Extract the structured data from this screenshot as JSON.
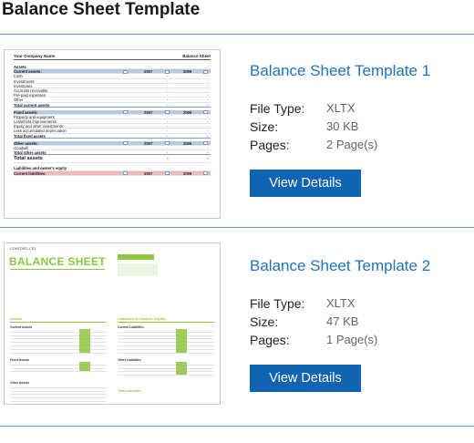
{
  "page": {
    "heading": "Balance Sheet Template"
  },
  "labels": {
    "file_type": "File Type:",
    "size": "Size:",
    "pages": "Pages:"
  },
  "templates": [
    {
      "title": "Balance Sheet Template 1",
      "file_type": "XLTX",
      "size": "30 KB",
      "pages": "2 Page(s)",
      "button": "View Details",
      "thumbnail": {
        "company": "Your Company Name",
        "sheet": "Balance Sheet",
        "rows": [
          {
            "t": "Assets",
            "k": "plain-bold"
          },
          {
            "t": "Current assets:",
            "k": "band",
            "y1": "2007",
            "y2": "2006"
          },
          {
            "t": "Cash",
            "k": "item"
          },
          {
            "t": "Investments",
            "k": "item"
          },
          {
            "t": "Inventories",
            "k": "item"
          },
          {
            "t": "Accounts receivable",
            "k": "item"
          },
          {
            "t": "Pre-paid expenses",
            "k": "item"
          },
          {
            "t": "Other",
            "k": "item"
          },
          {
            "t": "Total current assets",
            "k": "total"
          },
          {
            "t": "",
            "k": "gap"
          },
          {
            "t": "Fixed assets:",
            "k": "band",
            "y1": "2007",
            "y2": "2006"
          },
          {
            "t": "Property and equipment",
            "k": "item"
          },
          {
            "t": "Leasehold improvements",
            "k": "item"
          },
          {
            "t": "Equity and other investments",
            "k": "item"
          },
          {
            "t": "Less accumulated depreciation",
            "k": "item"
          },
          {
            "t": "Total fixed assets",
            "k": "total"
          },
          {
            "t": "",
            "k": "gap"
          },
          {
            "t": "Other assets:",
            "k": "band",
            "y1": "2007",
            "y2": "2006"
          },
          {
            "t": "Goodwill",
            "k": "item"
          },
          {
            "t": "Total other assets",
            "k": "total"
          },
          {
            "t": "Total assets",
            "k": "big"
          },
          {
            "t": "",
            "k": "gap"
          },
          {
            "t": "Liabilities and owner's equity",
            "k": "plain-bold"
          },
          {
            "t": "Current liabilities:",
            "k": "band-pink",
            "y1": "2007",
            "y2": "2006"
          }
        ]
      }
    },
    {
      "title": "Balance Sheet Template 2",
      "file_type": "XLTX",
      "size": "47 KB",
      "pages": "1 Page(s)",
      "button": "View Details",
      "thumbnail": {
        "company": "CONTOSO, LTD",
        "heading": "BALANCE SHEET",
        "assets": "Assets",
        "liabilities": "Liabilities & Owners' Equity",
        "current_assets": "Current Assets",
        "fixed_assets": "Fixed Assets",
        "other_assets": "Other Assets",
        "current_liabilities": "Current Liabilities",
        "other_liabilities": "Other Liabilities",
        "total_liabilities": "Total Liabilities"
      }
    }
  ]
}
